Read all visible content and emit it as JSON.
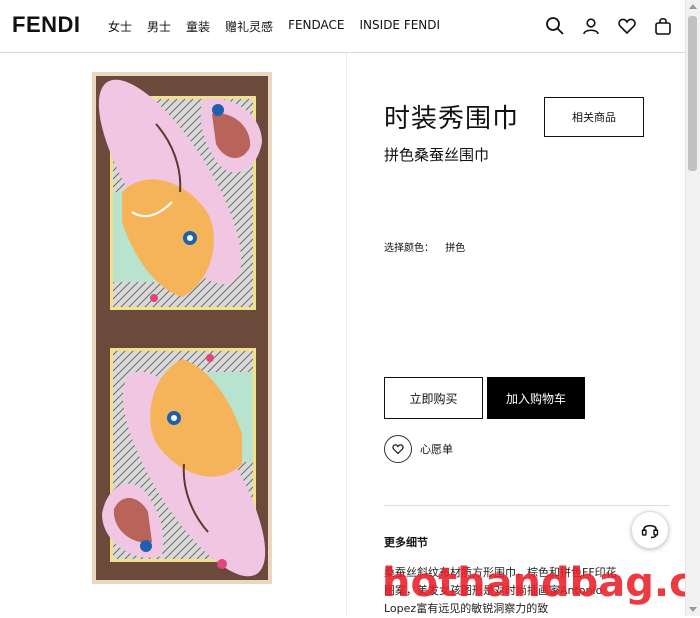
{
  "header": {
    "logo": "FENDI",
    "nav": [
      "女士",
      "男士",
      "童装",
      "赠礼灵感",
      "FENDACE",
      "INSIDE FENDI"
    ],
    "icons": [
      "search-icon",
      "account-icon",
      "heart-icon",
      "shopping-bag-icon"
    ]
  },
  "product": {
    "title": "时装秀围巾",
    "subtitle": "拼色桑蚕丝围巾",
    "related_label": "相关商品",
    "color_label": "选择颜色：",
    "color_value": "拼色",
    "buy_now_label": "立即购买",
    "add_to_cart_label": "加入购物车",
    "wishlist_label": "心愿单",
    "more_details_label": "更多细节",
    "description": "桑蚕丝斜纹布材质方形围巾，棕色和拼色FF印花图案，美发女孩图形是对时尚插画家Antonio Lopez富有远见的敏锐洞察力的致"
  },
  "watermark": "hothandbag.cn",
  "colors": {
    "scarf_border": "#6b4a3c",
    "scarf_frame": "#ead7c0",
    "cart_button_bg": "#000000",
    "watermark": "#e81e26"
  }
}
